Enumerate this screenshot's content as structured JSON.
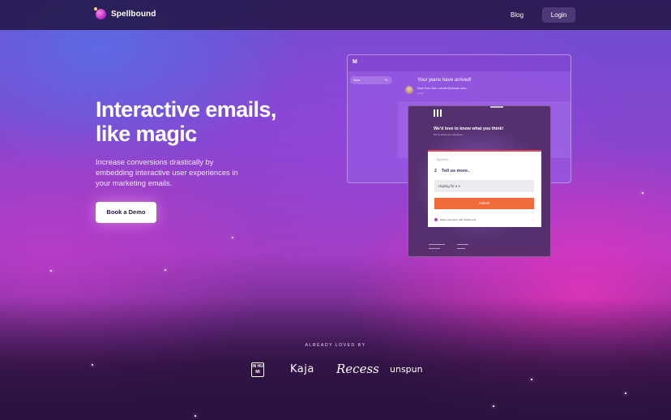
{
  "nav": {
    "brand": "Spellbound",
    "blog": "Blog",
    "login": "Login"
  },
  "hero": {
    "title_line1": "Interactive emails,",
    "title_line2": "like magic",
    "subtitle": "Increase conversions drastically by embedding interactive user experiences in your marketing emails.",
    "cta": "Book a Demo"
  },
  "mockup": {
    "mail_icon": "M",
    "inbox_label": "Inbox",
    "inbox_count": "75",
    "subject": "Your jeans have arrived!",
    "from_name": "Dane from Jean",
    "from_email": "<sender@domain.com>",
    "to_line": "to me",
    "email_question": "We'd love to know what you think!",
    "email_question_sub": "Tell us about your experience",
    "form_brand": "Typeform",
    "form_number": "2",
    "form_question": "Tell us more..",
    "form_input_value": "Hoping for a s",
    "form_submit": "Submit",
    "form_footer": "Made interactive with Spellbound"
  },
  "social_proof": {
    "heading": "ALREADY LOVED BY",
    "logos": [
      "IN HU MI",
      "Kaja",
      "Recess",
      "unspun"
    ]
  },
  "colors": {
    "cta_bg": "#ffffff",
    "submit": "#f06a3a",
    "accent": "#c238c7"
  }
}
